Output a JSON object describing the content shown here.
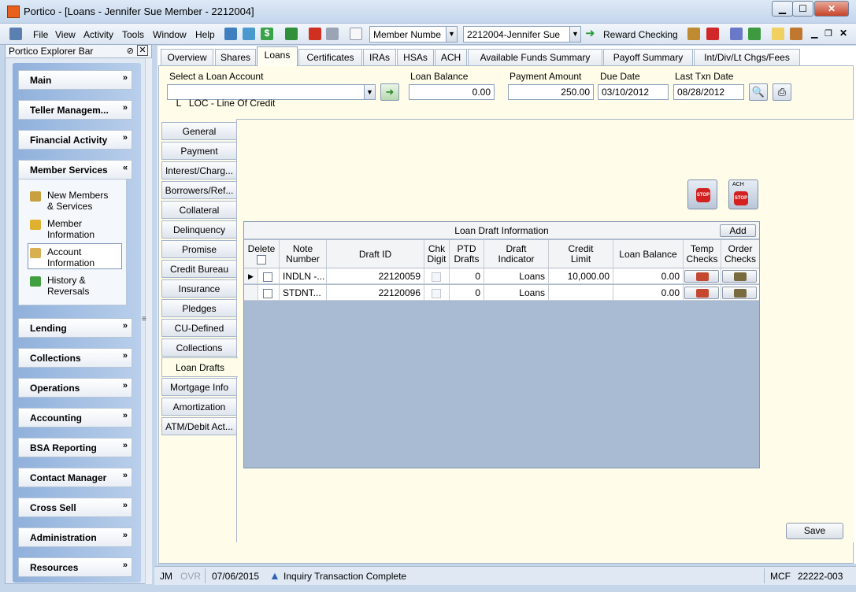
{
  "window": {
    "title": "Portico - [Loans - Jennifer Sue Member - 2212004]"
  },
  "menubar": {
    "items": [
      "File",
      "View",
      "Activity",
      "Tools",
      "Window",
      "Help"
    ],
    "member_lookup_field": "Member Numbe",
    "member_selected": "2212004-Jennifer Sue",
    "quick_account_link": "Reward Checking"
  },
  "explorer": {
    "title": "Portico Explorer Bar",
    "groups": [
      "Main",
      "Teller Managem...",
      "Financial Activity",
      "Member Services",
      "Lending",
      "Collections",
      "Operations",
      "Accounting",
      "BSA Reporting",
      "Contact Manager",
      "Cross Sell",
      "Administration",
      "Resources"
    ],
    "member_services_items": [
      {
        "line1": "New Members",
        "line2": "& Services"
      },
      {
        "line1": "Member",
        "line2": "Information"
      },
      {
        "line1": "Account",
        "line2": "Information"
      },
      {
        "line1": "History &",
        "line2": "Reversals"
      }
    ]
  },
  "tabs": [
    "Overview",
    "Shares",
    "Loans",
    "Certificates",
    "IRAs",
    "HSAs",
    "ACH",
    "Available Funds Summary",
    "Payoff Summary",
    "Int/Div/Lt Chgs/Fees"
  ],
  "loan_header": {
    "select_label": "Select a Loan Account",
    "selected_account": "L   LOC - Line Of Credit",
    "balance_label": "Loan Balance",
    "balance_value": "0.00",
    "payment_label": "Payment Amount",
    "payment_value": "250.00",
    "due_label": "Due Date",
    "due_value": "03/10/2012",
    "last_txn_label": "Last Txn Date",
    "last_txn_value": "08/28/2012"
  },
  "side_tabs": [
    "General",
    "Payment",
    "Interest/Charg...",
    "Borrowers/Ref...",
    "Collateral",
    "Delinquency",
    "Promise",
    "Credit Bureau",
    "Insurance",
    "Pledges",
    "CU-Defined",
    "Collections",
    "Loan Drafts",
    "Mortgage Info",
    "Amortization",
    "ATM/Debit Act..."
  ],
  "big_icons": {
    "ach_label": "ACH",
    "stop_label": "STOP"
  },
  "draft_grid": {
    "title": "Loan Draft Information",
    "add_label": "Add",
    "headers": {
      "delete": "Delete",
      "note_number": [
        "Note",
        "Number"
      ],
      "draft_id": "Draft ID",
      "chk_digit": [
        "Chk",
        "Digit"
      ],
      "ptd_drafts": [
        "PTD",
        "Drafts"
      ],
      "draft_indicator": [
        "Draft",
        "Indicator"
      ],
      "credit_limit": [
        "Credit",
        "Limit"
      ],
      "loan_balance": "Loan Balance",
      "temp_checks": [
        "Temp",
        "Checks"
      ],
      "order_checks": [
        "Order",
        "Checks"
      ]
    },
    "rows": [
      {
        "note": "INDLN -...",
        "draft_id": "22120059",
        "ptd": "0",
        "indicator": "Loans",
        "credit_limit": "10,000.00",
        "balance": "0.00"
      },
      {
        "note": "STDNT...",
        "draft_id": "22120096",
        "ptd": "0",
        "indicator": "Loans",
        "credit_limit": "",
        "balance": "0.00"
      }
    ]
  },
  "save_label": "Save",
  "status": {
    "user": "JM",
    "ovr": "OVR",
    "date": "07/06/2015",
    "message": "Inquiry Transaction Complete",
    "mcf": "MCF",
    "station": "22222-003"
  },
  "colors": {
    "accent": "#2f63b8",
    "panel": "#fffde9",
    "explorer_gradient": "#8fb0db"
  }
}
